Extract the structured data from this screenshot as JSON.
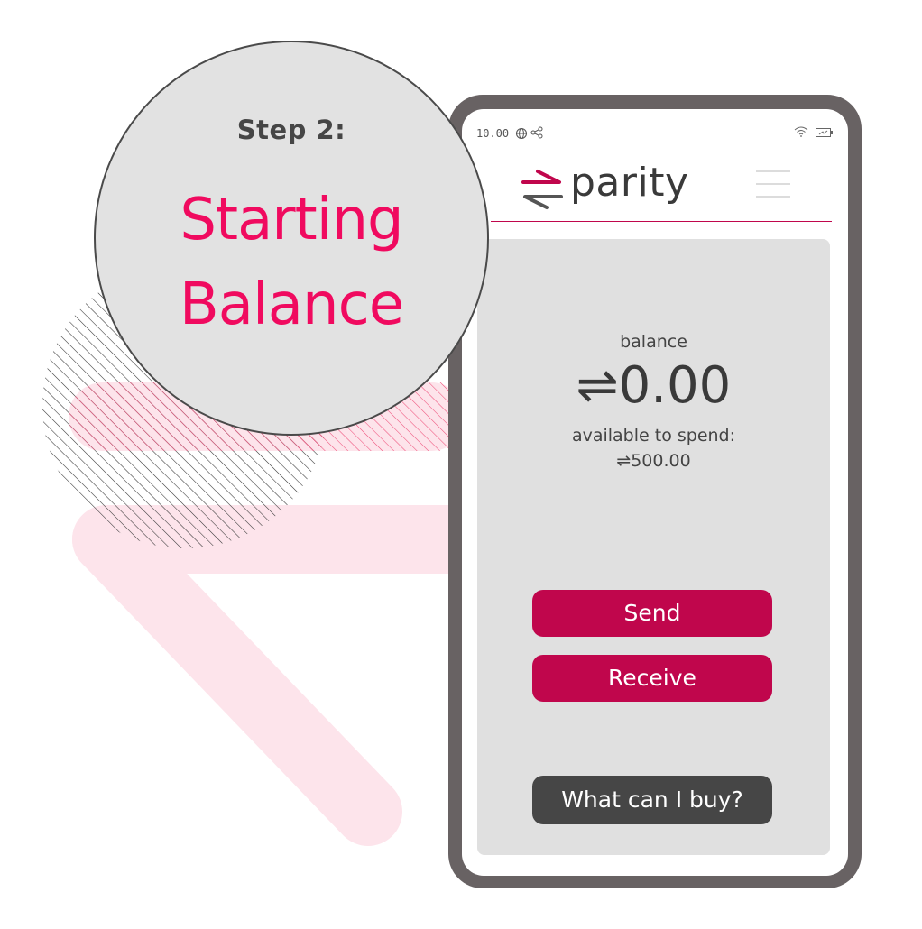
{
  "callout": {
    "step": "Step 2:",
    "title_line1": "Starting",
    "title_line2": "Balance"
  },
  "status_bar": {
    "time": "10.00"
  },
  "header": {
    "brand_name": "parity"
  },
  "balance": {
    "label": "balance",
    "amount": "⇌0.00",
    "available_label": "available to spend:",
    "available_amount": "⇌500.00"
  },
  "actions": {
    "send": "Send",
    "receive": "Receive",
    "what_can_i_buy": "What can I buy?"
  },
  "colors": {
    "accent": "#c0064c",
    "headline": "#f00a5f",
    "phone_frame": "#686263",
    "card": "#e0e0e0",
    "dark_button": "#464646",
    "decoration_pink": "#fde4eb"
  },
  "icons": [
    "globe-icon",
    "share-icon",
    "wifi-icon",
    "battery-icon",
    "parity-logo-icon",
    "hamburger-menu-icon"
  ]
}
